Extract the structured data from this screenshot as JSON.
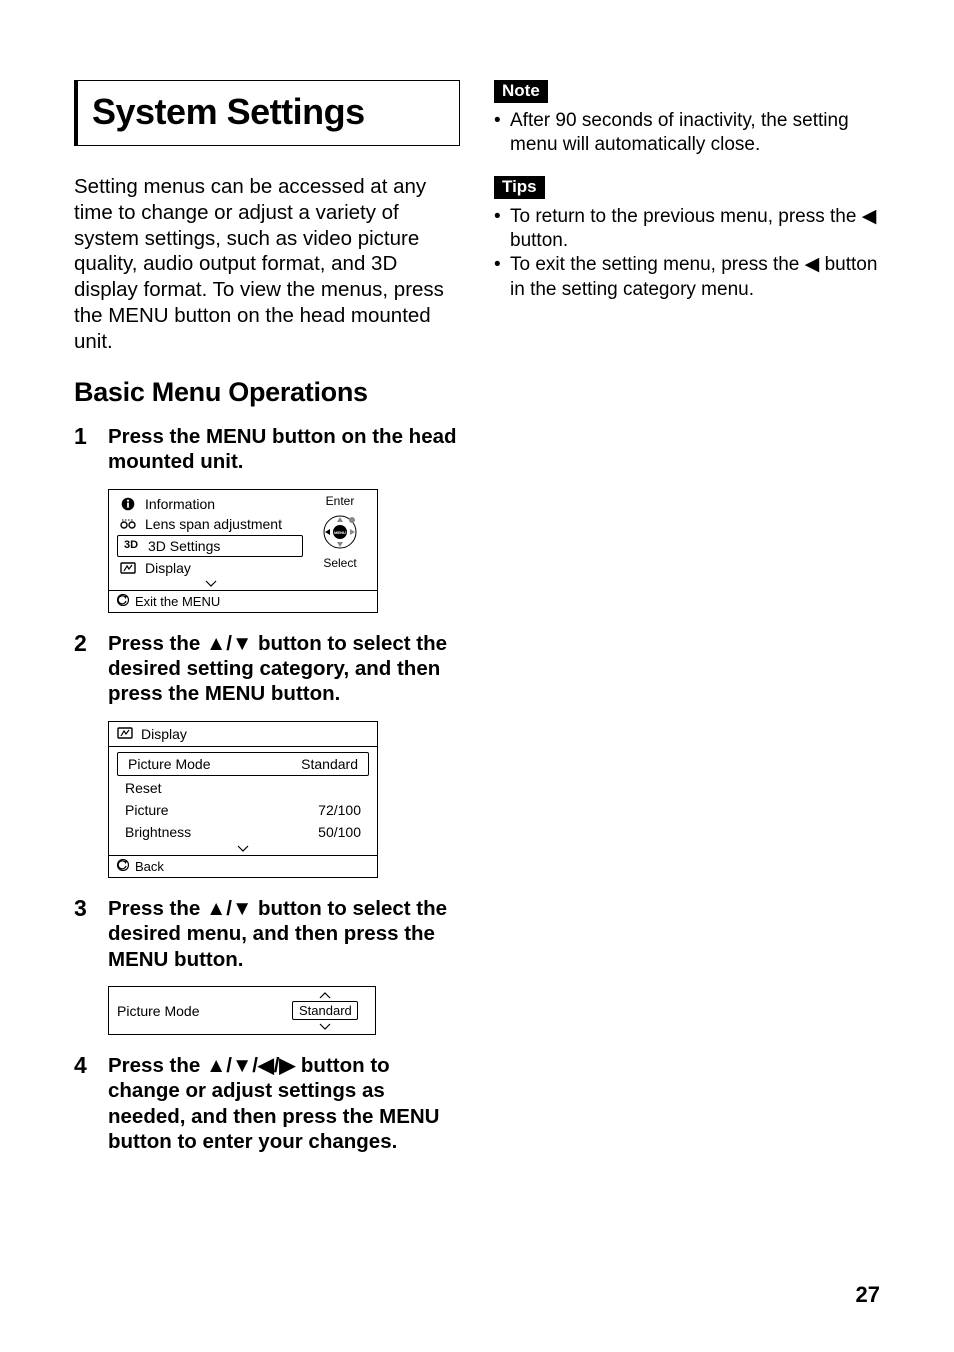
{
  "page_title": "System Settings",
  "intro": "Setting menus can be accessed at any time to change or adjust a variety of system settings, such as video picture quality, audio output format, and 3D display format. To view the menus, press the MENU button on the head mounted unit.",
  "subheading": "Basic Menu Operations",
  "steps": {
    "s1": {
      "num": "1",
      "text": "Press the MENU button on the head mounted unit."
    },
    "s2": {
      "num": "2",
      "pre": "Press the ",
      "arrows": "▲/▼",
      "post": " button to select the desired setting category, and then press the MENU button."
    },
    "s3": {
      "num": "3",
      "pre": "Press the ",
      "arrows": "▲/▼",
      "post": " button to select the desired menu, and then press the MENU button."
    },
    "s4": {
      "num": "4",
      "pre": "Press the ",
      "arrows": "▲/▼/◀/▶",
      "post": " button to change or adjust settings as needed, and then press the MENU button to enter your changes."
    }
  },
  "fig1": {
    "items": {
      "info": "Information",
      "lens": "Lens span adjustment",
      "threed_label": "3D",
      "threed_text": "3D Settings",
      "display": "Display"
    },
    "right": {
      "enter": "Enter",
      "select": "Select",
      "menu": "MENU"
    },
    "footer": "Exit the MENU"
  },
  "fig2": {
    "head": "Display",
    "rows": {
      "pm_label": "Picture Mode",
      "pm_value": "Standard",
      "reset": "Reset",
      "picture_label": "Picture",
      "picture_value": "72/100",
      "bright_label": "Brightness",
      "bright_value": "50/100"
    },
    "footer": "Back"
  },
  "fig3": {
    "label": "Picture Mode",
    "value": "Standard"
  },
  "right_col": {
    "note_tag": "Note",
    "note_text": "After 90 seconds of inactivity, the setting menu will automatically close.",
    "tips_tag": "Tips",
    "tip1_pre": "To return to the previous menu, press the ",
    "tip1_sym": "◀",
    "tip1_post": " button.",
    "tip2_pre": "To exit the setting menu, press the ",
    "tip2_sym": "◀",
    "tip2_post": " button in the setting category menu."
  },
  "page_number": "27"
}
